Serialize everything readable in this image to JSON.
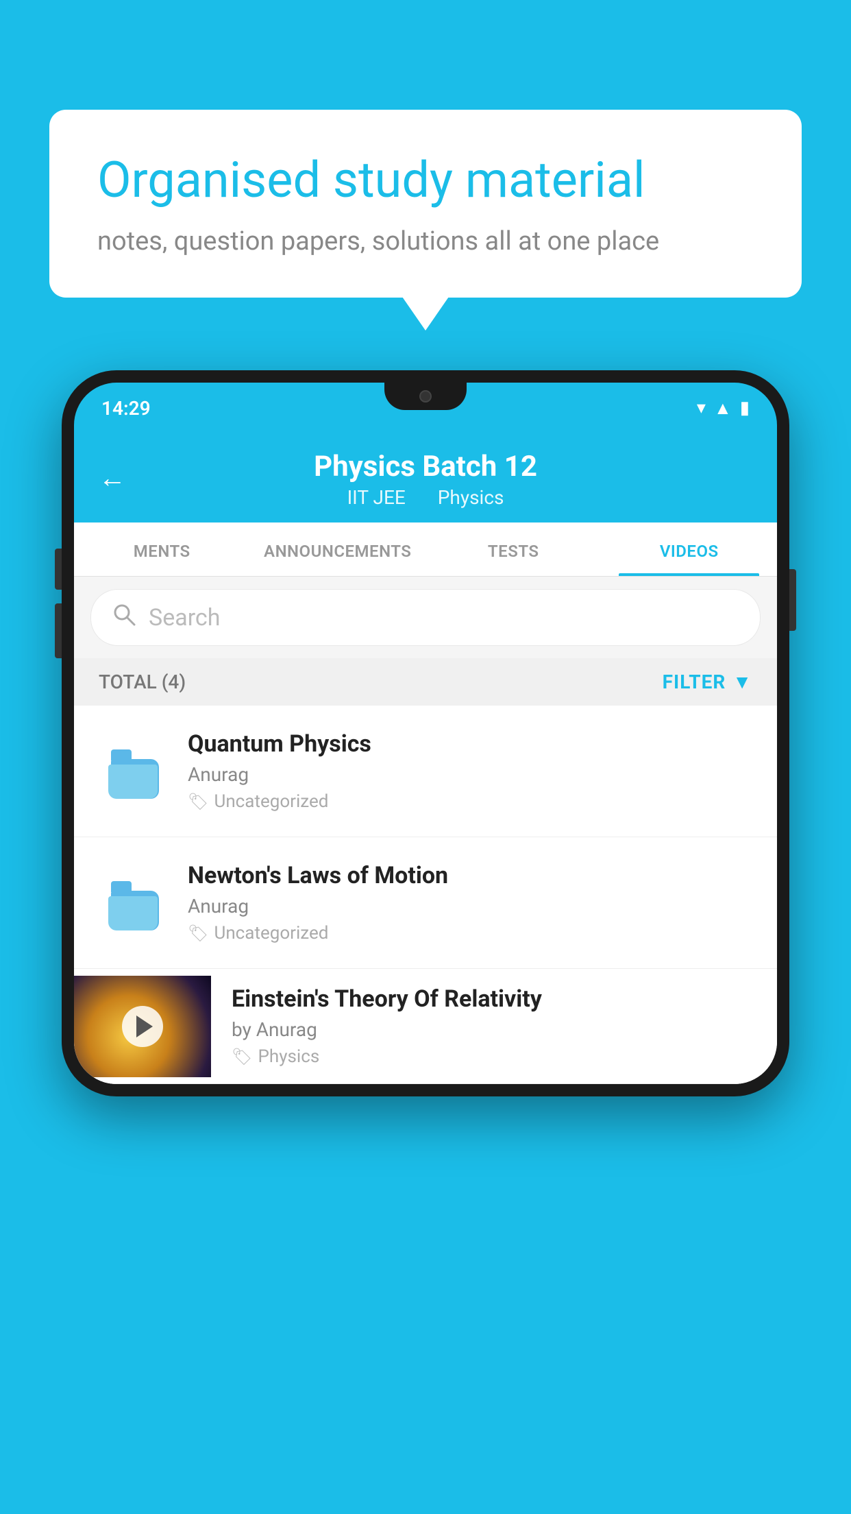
{
  "background_color": "#1bbde8",
  "bubble": {
    "title": "Organised study material",
    "subtitle": "notes, question papers, solutions all at one place"
  },
  "phone": {
    "status_bar": {
      "time": "14:29"
    },
    "header": {
      "title": "Physics Batch 12",
      "subtitle_part1": "IIT JEE",
      "subtitle_part2": "Physics",
      "back_label": "←"
    },
    "tabs": [
      {
        "label": "MENTS",
        "active": false
      },
      {
        "label": "ANNOUNCEMENTS",
        "active": false
      },
      {
        "label": "TESTS",
        "active": false
      },
      {
        "label": "VIDEOS",
        "active": true
      }
    ],
    "search": {
      "placeholder": "Search"
    },
    "filter_bar": {
      "total_label": "TOTAL (4)",
      "filter_label": "FILTER"
    },
    "videos": [
      {
        "id": 1,
        "title": "Quantum Physics",
        "author": "Anurag",
        "tag": "Uncategorized",
        "has_thumbnail": false
      },
      {
        "id": 2,
        "title": "Newton's Laws of Motion",
        "author": "Anurag",
        "tag": "Uncategorized",
        "has_thumbnail": false
      },
      {
        "id": 3,
        "title": "Einstein's Theory Of Relativity",
        "author": "by Anurag",
        "tag": "Physics",
        "has_thumbnail": true
      }
    ]
  }
}
